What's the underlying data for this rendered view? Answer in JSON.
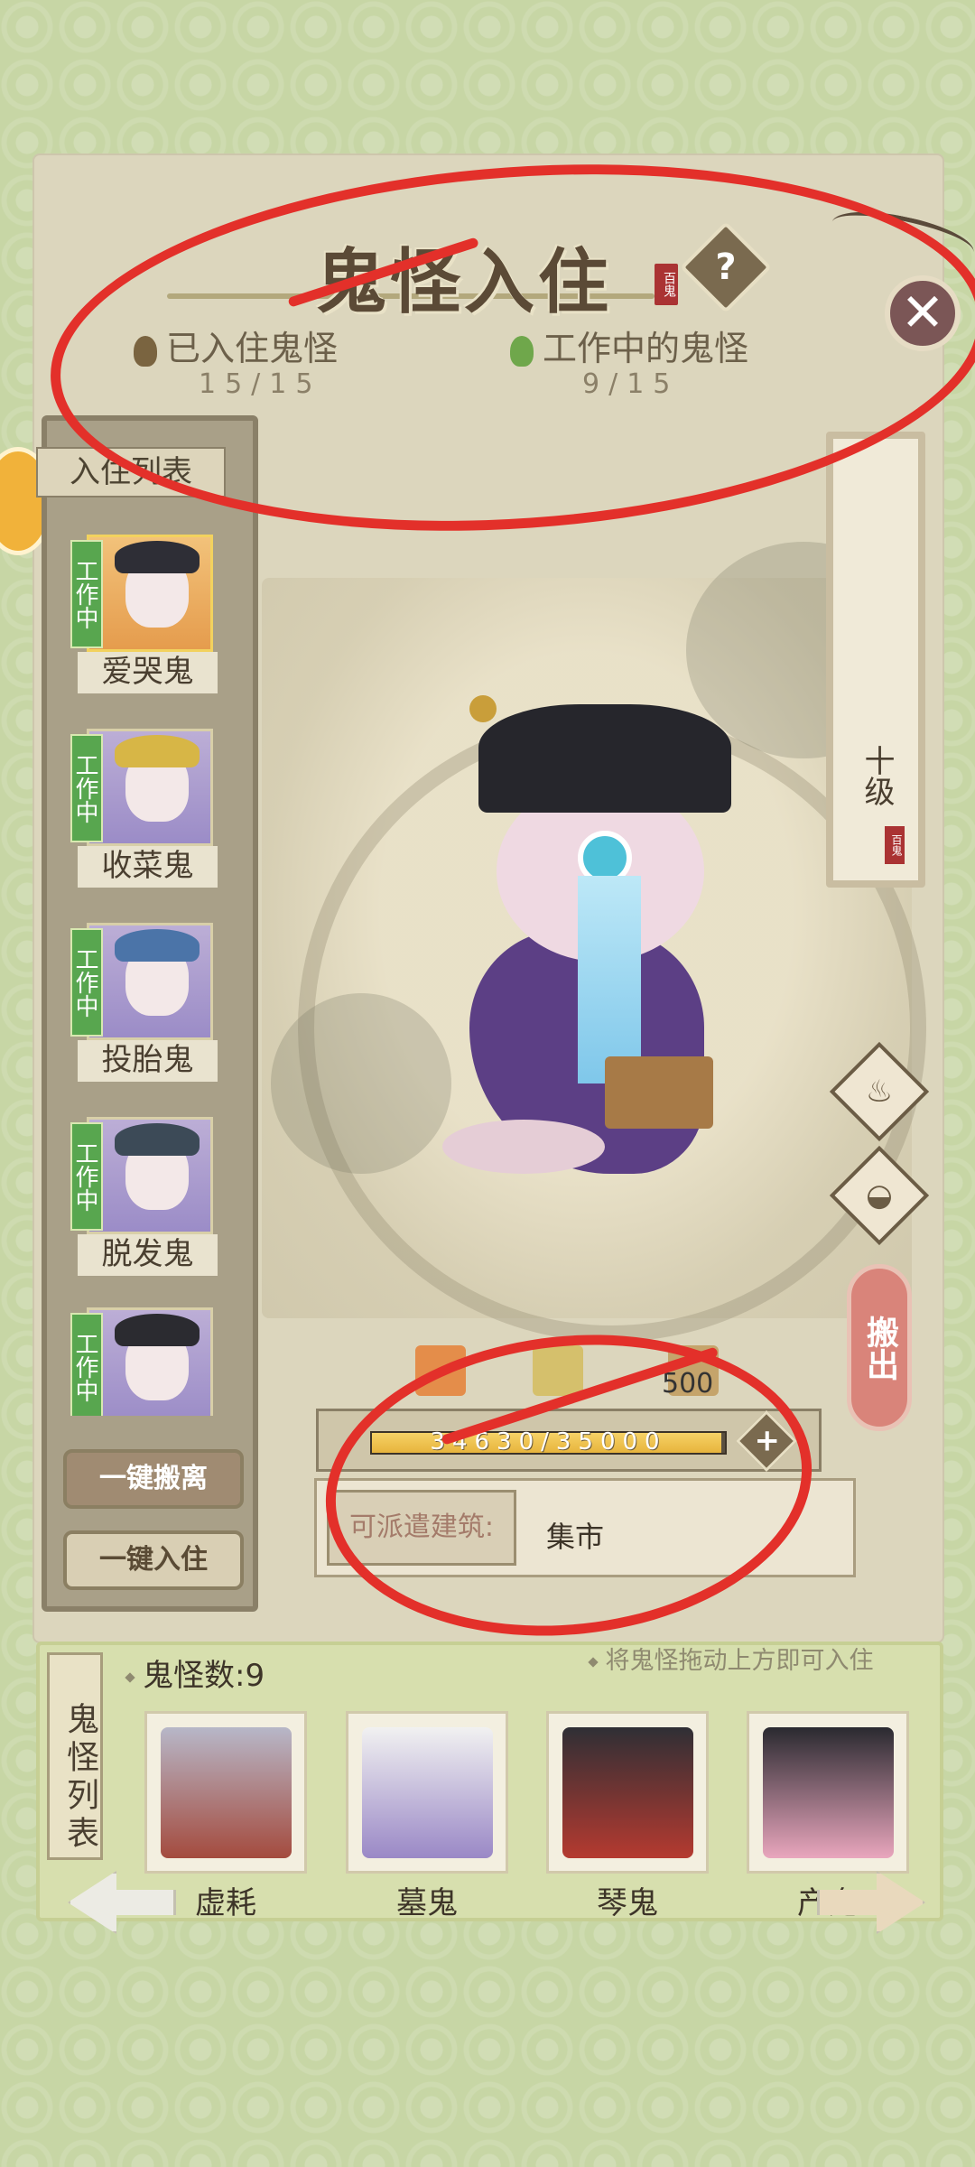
{
  "title": "鬼怪入住",
  "title_seal": "百鬼",
  "stats": {
    "resident_label": "已入住鬼怪",
    "resident_value": "15/15",
    "working_label": "工作中的鬼怪",
    "working_value": "9/15"
  },
  "resident_list": {
    "header": "入住列表",
    "badge": "工作中",
    "items": [
      {
        "name": "爱哭鬼"
      },
      {
        "name": "收菜鬼"
      },
      {
        "name": "投胎鬼"
      },
      {
        "name": "脱发鬼"
      },
      {
        "name": ""
      }
    ],
    "evict_all_label": "一键搬离",
    "move_in_all_label": "一键入住"
  },
  "level": {
    "label": "十级",
    "seal": "百鬼"
  },
  "move_out_label": "搬出",
  "cost": "500",
  "capacity": {
    "current": 34630,
    "max": 35000,
    "text": "34630/35000"
  },
  "dispatch": {
    "label": "可派遣建筑:",
    "value": "集市"
  },
  "roster": {
    "tab_label": "鬼怪列表",
    "count_label": "鬼怪数:9",
    "hint": "将鬼怪拖动上方即可入住",
    "items": [
      {
        "name": "虚耗"
      },
      {
        "name": "墓鬼"
      },
      {
        "name": "琴鬼"
      },
      {
        "name": "产鬼"
      }
    ]
  },
  "colors": {
    "accent_red_annotation": "#e3302a",
    "working_badge": "#58a64f",
    "background": "#c7d6a5"
  },
  "icons": [
    "help-icon",
    "close-icon",
    "flame-icon",
    "ghost-skill-icon",
    "bag-icon",
    "plus-icon",
    "arrow-left-icon",
    "arrow-right-icon"
  ]
}
